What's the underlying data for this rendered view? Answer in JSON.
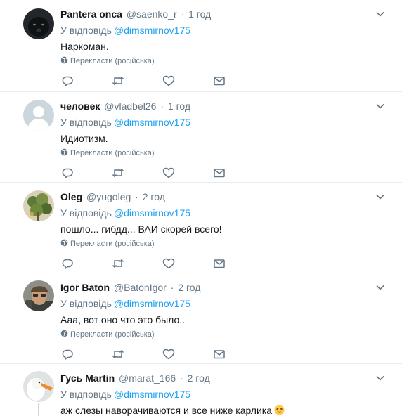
{
  "reply_prefix": "У відповідь",
  "translate_label": "Перекласти (російська)",
  "colors": {
    "link": "#1da1f2",
    "secondary_text": "#657786",
    "primary_text": "#14171a",
    "divider": "#e6ecf0"
  },
  "icons": {
    "reply": "reply-icon",
    "retweet": "retweet-icon",
    "like": "heart-icon",
    "dm": "envelope-icon",
    "caret": "chevron-down-icon",
    "globe": "globe-icon"
  },
  "tweets": [
    {
      "fullname": "Pantera onca",
      "username": "@saenko_r",
      "time": "1 год",
      "reply_to": "@dimsmirnov175",
      "text": "Наркоман."
    },
    {
      "fullname": "человек",
      "username": "@vladbel26",
      "time": "1 год",
      "reply_to": "@dimsmirnov175",
      "text": "Идиотизм."
    },
    {
      "fullname": "Oleg",
      "username": "@yugoleg",
      "time": "2 год",
      "reply_to": "@dimsmirnov175",
      "text": "пошло... гибдд... ВАИ скорей всего!"
    },
    {
      "fullname": "Igor Baton",
      "username": "@BatonIgor",
      "time": "2 год",
      "reply_to": "@dimsmirnov175",
      "text": "Ааа, вот оно что это было.."
    },
    {
      "fullname": "Гусь Martin",
      "username": "@marat_166",
      "time": "2 год",
      "reply_to": "@dimsmirnov175",
      "text": "аж слезы наворачиваются и все ниже карлика",
      "emoji": "persevering-face-emoji"
    }
  ]
}
